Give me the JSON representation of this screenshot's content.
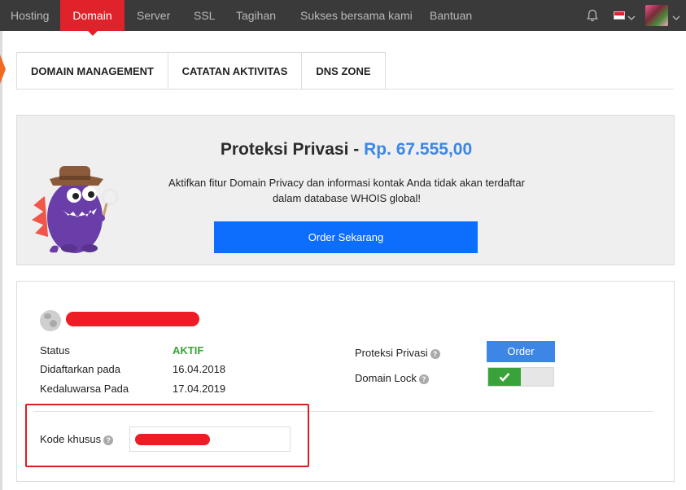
{
  "nav": {
    "items": [
      {
        "label": "Hosting"
      },
      {
        "label": "Domain"
      },
      {
        "label": "Server"
      },
      {
        "label": "SSL"
      },
      {
        "label": "Tagihan"
      },
      {
        "label": "Sukses bersama kami"
      },
      {
        "label": "Bantuan"
      }
    ],
    "active_index": 1,
    "icons": [
      "bell-icon",
      "flag-indonesia-icon",
      "chevron-down-icon",
      "avatar",
      "chevron-down-icon"
    ]
  },
  "tabs": [
    {
      "label": "DOMAIN MANAGEMENT"
    },
    {
      "label": "CATATAN AKTIVITAS"
    },
    {
      "label": "DNS ZONE"
    }
  ],
  "promo": {
    "title": "Proteksi Privasi - ",
    "price": "Rp. 67.555,00",
    "text": "Aktifkan fitur Domain Privacy dan informasi kontak Anda tidak akan terdaftar dalam database WHOIS global!",
    "button": "Order Sekarang"
  },
  "domain": {
    "rows": [
      {
        "label": "Status",
        "value": "AKTIF"
      },
      {
        "label": "Didaftarkan pada",
        "value": "16.04.2018"
      },
      {
        "label": "Kedaluwarsa Pada",
        "value": "17.04.2019"
      }
    ],
    "privacy_label": "Proteksi Privasi",
    "privacy_button": "Order",
    "lock_label": "Domain Lock",
    "lock_enabled": true,
    "code_label": "Kode khusus",
    "help_glyph": "?"
  },
  "colors": {
    "nav_bg": "#3a3a3a",
    "nav_active": "#e0232a",
    "accent_blue": "#0d6efd",
    "price_blue": "#3d86e6",
    "active_green": "#3aa23a",
    "redaction": "#ee1c24"
  }
}
